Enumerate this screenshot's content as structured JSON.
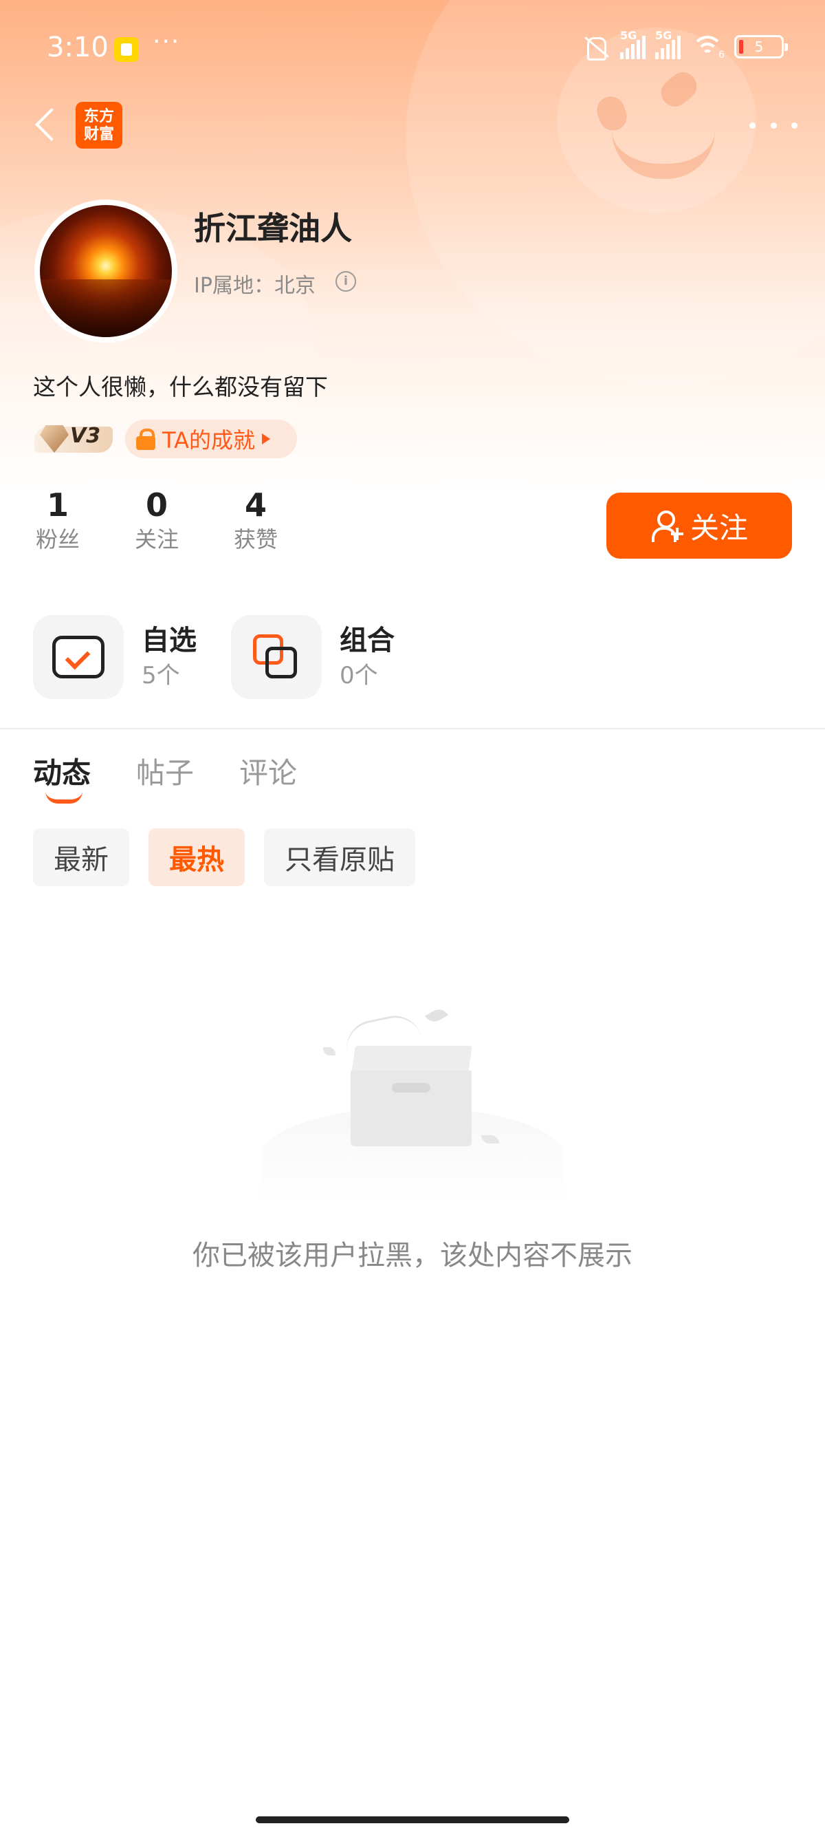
{
  "status_bar": {
    "time": "3:10",
    "dots": "···",
    "signal1_label": "5G",
    "signal2_label": "5G",
    "wifi_badge": "6",
    "battery": "5"
  },
  "nav": {
    "logo_line1": "东方",
    "logo_line2": "财富"
  },
  "profile": {
    "name": "折江聋油人",
    "ip_location": "IP属地：北京",
    "bio": "这个人很懒，什么都没有留下",
    "level": "V3",
    "achievement_label": "TA的成就"
  },
  "stats": [
    {
      "value": "1",
      "label": "粉丝"
    },
    {
      "value": "0",
      "label": "关注"
    },
    {
      "value": "4",
      "label": "获赞"
    }
  ],
  "follow_button": "关注",
  "quick_access": [
    {
      "title": "自选",
      "count": "5个",
      "icon": "watchlist-check-icon"
    },
    {
      "title": "组合",
      "count": "0个",
      "icon": "portfolio-icon"
    }
  ],
  "tabs": [
    {
      "label": "动态",
      "active": true
    },
    {
      "label": "帖子",
      "active": false
    },
    {
      "label": "评论",
      "active": false
    }
  ],
  "filters": [
    {
      "label": "最新",
      "active": false
    },
    {
      "label": "最热",
      "active": true
    },
    {
      "label": "只看原贴",
      "active": false
    }
  ],
  "empty_state": {
    "message": "你已被该用户拉黑，该处内容不展示"
  },
  "colors": {
    "accent": "#ff5a00",
    "header_gradient_top": "#ffb184"
  }
}
